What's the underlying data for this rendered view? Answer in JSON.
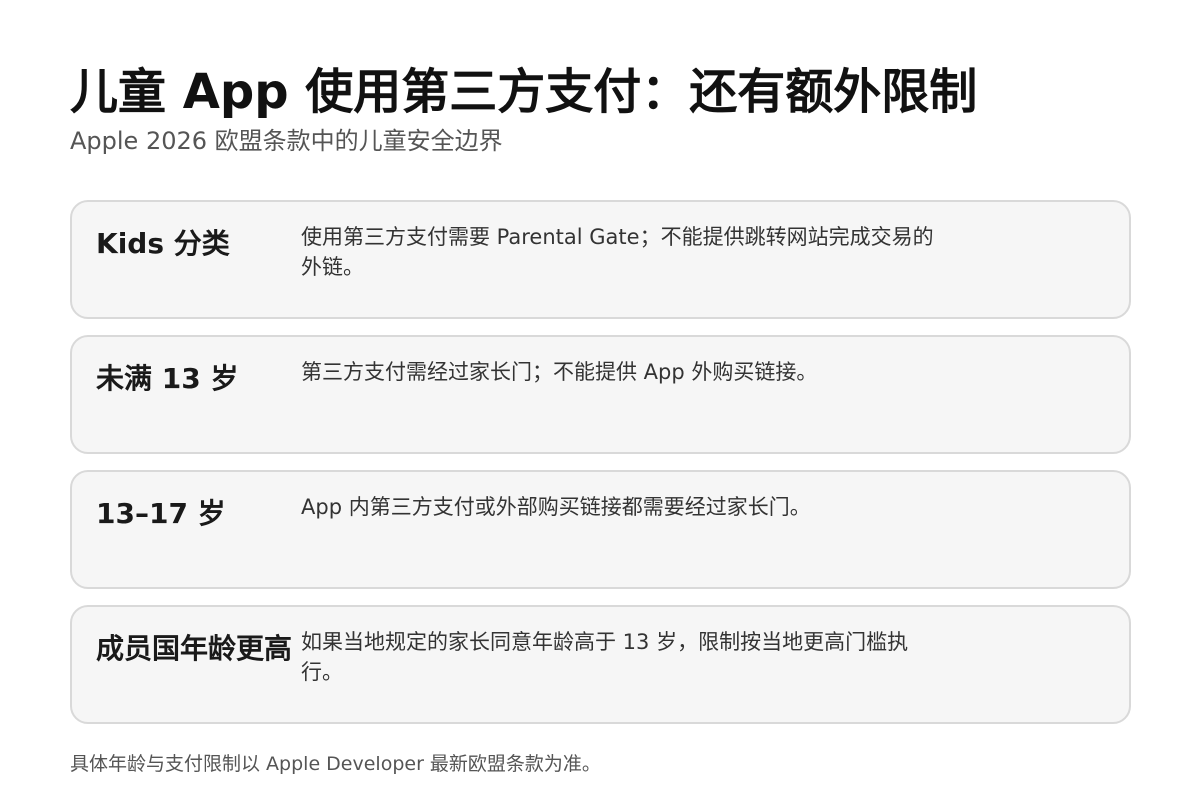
{
  "title": "儿童 App 使用第三方支付：还有额外限制",
  "subtitle": "Apple 2026 欧盟条款中的儿童安全边界",
  "rules": [
    {
      "label": "Kids 分类",
      "text": "使用第三方支付需要 Parental Gate；不能提供跳转网站完成交易的外链。"
    },
    {
      "label": "未满 13 岁",
      "text": "第三方支付需经过家长门；不能提供 App 外购买链接。"
    },
    {
      "label": "13–17 岁",
      "text": "App 内第三方支付或外部购买链接都需要经过家长门。"
    },
    {
      "label": "成员国年龄更高",
      "text": "如果当地规定的家长同意年龄高于 13 岁，限制按当地更高门槛执行。"
    }
  ],
  "footnote": "具体年龄与支付限制以 Apple Developer 最新欧盟条款为准。"
}
